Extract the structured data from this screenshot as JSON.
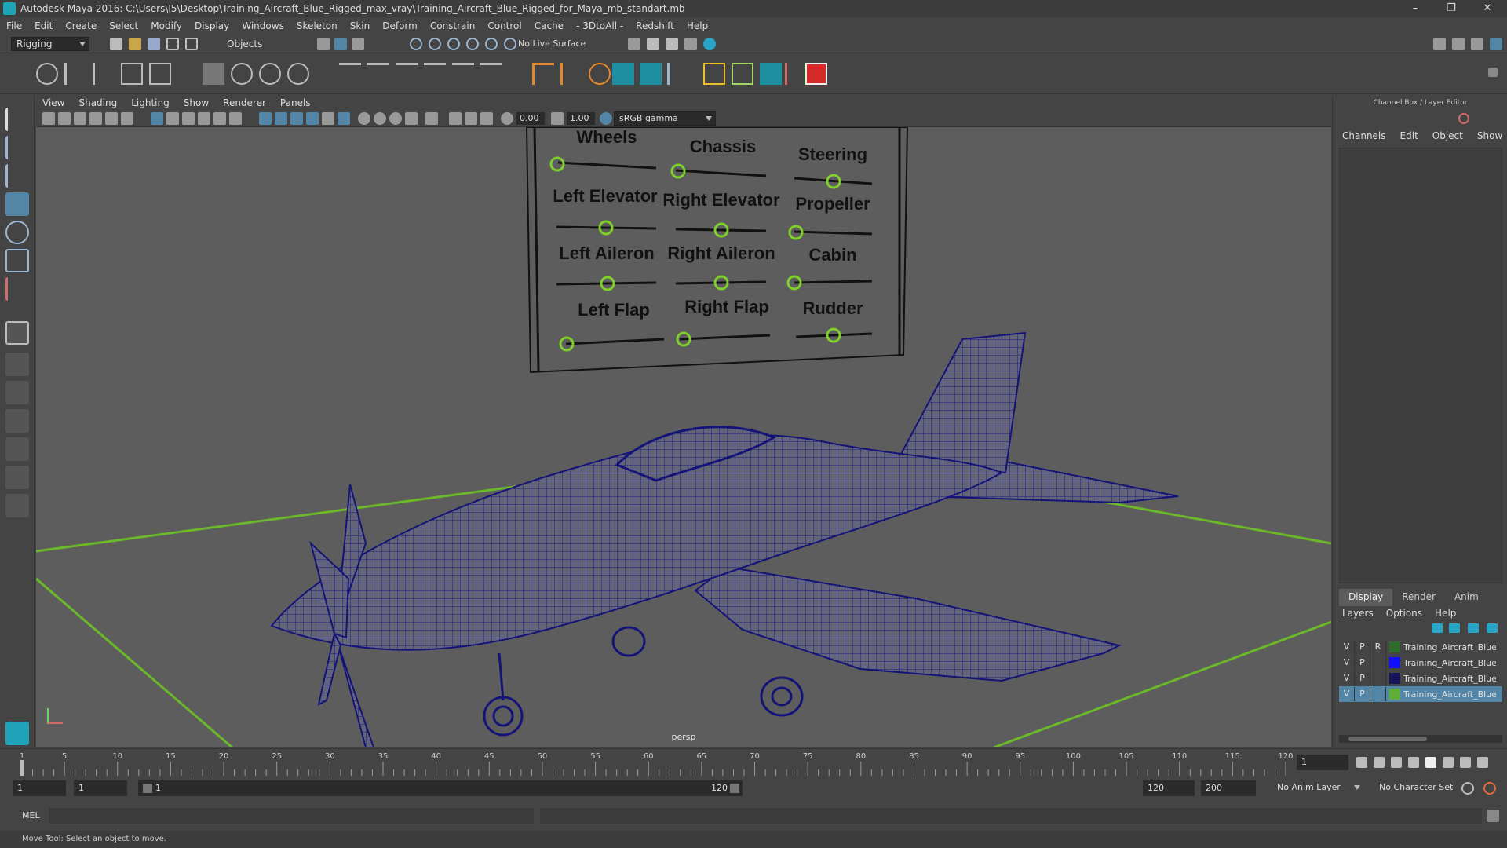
{
  "window": {
    "title": "Autodesk Maya 2016: C:\\Users\\I5\\Desktop\\Training_Aircraft_Blue_Rigged_max_vray\\Training_Aircraft_Blue_Rigged_for_Maya_mb_standart.mb",
    "min_label": "–",
    "max_label": "❐",
    "close_label": "✕"
  },
  "menu": [
    "File",
    "Edit",
    "Create",
    "Select",
    "Modify",
    "Display",
    "Windows",
    "Skeleton",
    "Skin",
    "Deform",
    "Constrain",
    "Control",
    "Cache",
    "- 3DtoAll -",
    "Redshift",
    "Help"
  ],
  "statusline": {
    "mode": "Rigging",
    "selection_mode": "Objects",
    "live_surface": "No Live Surface"
  },
  "panel": {
    "menus": [
      "View",
      "Shading",
      "Lighting",
      "Show",
      "Renderer",
      "Panels"
    ],
    "exposure": "0.00",
    "gamma": "1.00",
    "color_space": "sRGB gamma",
    "camera": "persp"
  },
  "control_board": {
    "labels": [
      "Wheels",
      "Chassis",
      "Steering",
      "Left Elevator",
      "Right Elevator",
      "Propeller",
      "Left Aileron",
      "Right Aileron",
      "Cabin",
      "Left Flap",
      "Right Flap",
      "Rudder"
    ]
  },
  "channel_box": {
    "title": "Channel Box / Layer Editor",
    "menus": [
      "Channels",
      "Edit",
      "Object",
      "Show"
    ]
  },
  "layer_editor": {
    "tabs": [
      "Display",
      "Render",
      "Anim"
    ],
    "active_tab": "Display",
    "menus": [
      "Layers",
      "Options",
      "Help"
    ],
    "layers": [
      {
        "v": "V",
        "p": "P",
        "r": "R",
        "color": "#2f6b2f",
        "name": "Training_Aircraft_Blue_"
      },
      {
        "v": "V",
        "p": "P",
        "r": "",
        "color": "#1010ff",
        "name": "Training_Aircraft_Blue_"
      },
      {
        "v": "V",
        "p": "P",
        "r": "",
        "color": "#14145a",
        "name": "Training_Aircraft_Blue_"
      },
      {
        "v": "V",
        "p": "P",
        "r": "",
        "color": "#5fae3a",
        "name": "Training_Aircraft_Blue_"
      }
    ]
  },
  "timeline": {
    "ticks": [
      "1",
      "5",
      "10",
      "15",
      "20",
      "25",
      "30",
      "35",
      "40",
      "45",
      "50",
      "55",
      "60",
      "65",
      "70",
      "75",
      "80",
      "85",
      "90",
      "95",
      "100",
      "105",
      "110",
      "115",
      "120"
    ],
    "current_frame": "1",
    "playback_start": "1",
    "range_start": "1",
    "range_slider_start": "1",
    "range_slider_end": "120",
    "range_end": "120",
    "playback_end": "200",
    "anim_layer": "No Anim Layer",
    "character_set": "No Character Set"
  },
  "command": {
    "language": "MEL"
  },
  "help_line": "Move Tool: Select an object to move."
}
